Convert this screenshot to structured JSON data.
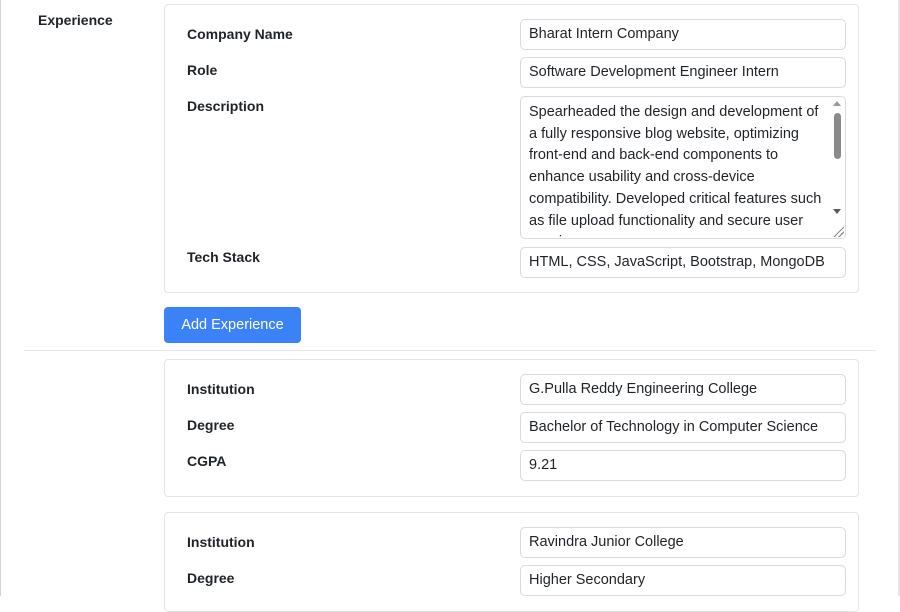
{
  "experience_section": {
    "label": "Experience",
    "entry": {
      "company_name_label": "Company Name",
      "company_name_value": "Bharat Intern Company",
      "role_label": "Role",
      "role_value": "Software Development Engineer Intern",
      "description_label": "Description",
      "description_value": "Spearheaded the design and development of a fully responsive blog website, optimizing front-end and back-end components to enhance usability and cross-device compatibility. Developed critical features such as file upload functionality and secure user session",
      "tech_stack_label": "Tech Stack",
      "tech_stack_value": "HTML, CSS, JavaScript, Bootstrap, MongoDB"
    },
    "add_button_label": "Add Experience"
  },
  "education_section": {
    "entries": [
      {
        "institution_label": "Institution",
        "institution_value": "G.Pulla Reddy Engineering College",
        "degree_label": "Degree",
        "degree_value": "Bachelor of Technology in Computer Science",
        "cgpa_label": "CGPA",
        "cgpa_value": "9.21"
      },
      {
        "institution_label": "Institution",
        "institution_value": "Ravindra Junior College",
        "degree_label": "Degree",
        "degree_value": "Higher Secondary"
      }
    ]
  },
  "colors": {
    "primary_button": "#3b82f6",
    "border": "#e2e4e8"
  }
}
